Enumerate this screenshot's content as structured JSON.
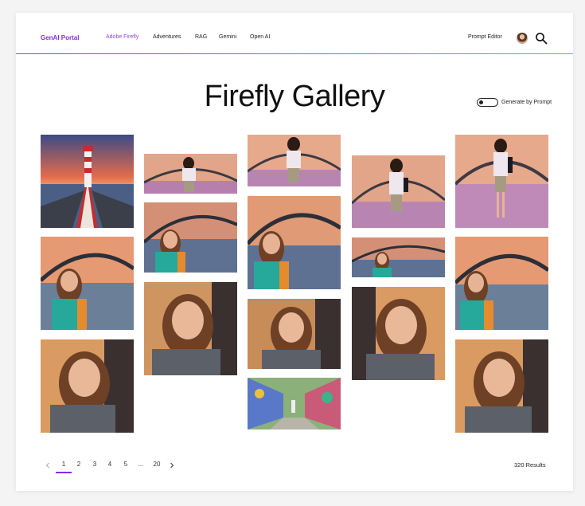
{
  "header": {
    "brand": "GenAI Portal",
    "nav": [
      "Adobe Firefly",
      "Adventures",
      "RAG",
      "Gemini",
      "Open AI"
    ],
    "active_nav": "Adobe Firefly",
    "prompt_editor": "Prompt Editor",
    "avatar": "user-avatar",
    "search_icon": "search-icon"
  },
  "colors": {
    "brand": "#8a2be2",
    "active_nav": "#9146ff",
    "divider_start": "#9b3df0",
    "divider_end": "#1fd1c9"
  },
  "page": {
    "title": "Firefly Gallery",
    "toggle_label": "Generate by Prompt",
    "toggle_on": false
  },
  "gallery": {
    "images": [
      {
        "subject": "lighthouse"
      },
      {
        "subject": "woman-bridge-full"
      },
      {
        "subject": "woman-bridge-full"
      },
      {
        "subject": "woman-bridge-full"
      },
      {
        "subject": "woman-bridge-full"
      },
      {
        "subject": "woman-bridge-portrait"
      },
      {
        "subject": "woman-bridge-portrait"
      },
      {
        "subject": "woman-bridge-portrait"
      },
      {
        "subject": "woman-bridge-portrait"
      },
      {
        "subject": "woman-bridge-portrait"
      },
      {
        "subject": "woman-closeup"
      },
      {
        "subject": "woman-closeup"
      },
      {
        "subject": "woman-closeup"
      },
      {
        "subject": "woman-closeup"
      },
      {
        "subject": "woman-closeup"
      },
      {
        "subject": "graffiti-alley"
      }
    ]
  },
  "pagination": {
    "prev_icon": "chevron-left-icon",
    "pages": [
      "1",
      "2",
      "3",
      "4",
      "5",
      "...",
      "20"
    ],
    "current": "1",
    "next_icon": "chevron-right-icon",
    "results": "320 Results"
  }
}
